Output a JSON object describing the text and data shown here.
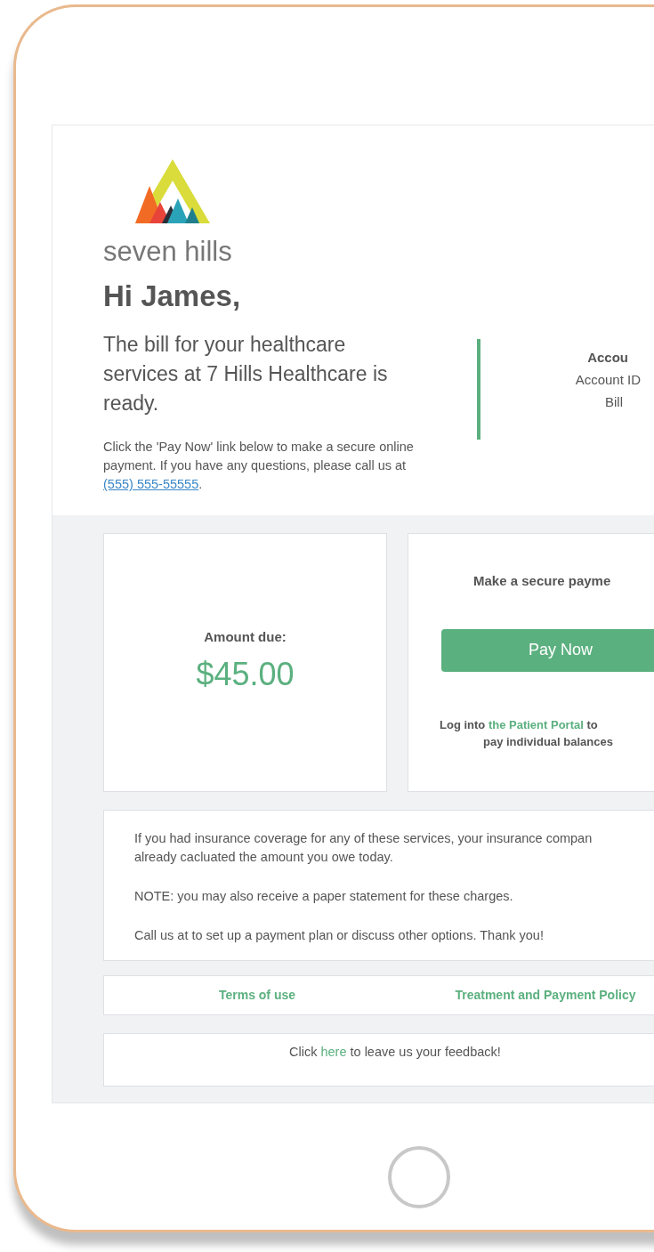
{
  "brand": {
    "name": "seven hills"
  },
  "greeting": "Hi James,",
  "intro": "The bill for your healthcare services at 7 Hills Healthcare is ready.",
  "instructions": {
    "text": "Click the 'Pay Now' link below to make a secure online payment. If you have any questions, please call us at",
    "phone": "(555) 555-55555",
    "after": "."
  },
  "account": {
    "heading": "Accou",
    "lines": [
      "Account ID",
      "Bill"
    ]
  },
  "amount": {
    "label": "Amount due:",
    "value": "$45.00"
  },
  "payment": {
    "heading": "Make a secure payme",
    "button": "Pay Now",
    "portal_before": "Log into",
    "portal_link": "the Patient Portal",
    "portal_after": "to",
    "portal_line2": "pay individual balances"
  },
  "notes": [
    "If you had insurance coverage for any of these services, your insurance compan already cacluated the amount you owe today.",
    "NOTE: you may also receive a paper statement for these charges.",
    "Call us at to set up a payment plan or discuss other options. Thank you!"
  ],
  "footer_links": [
    "Terms of use",
    "Treatment and Payment Policy"
  ],
  "feedback": {
    "before": "Click",
    "link": "here",
    "after": "to leave us your feedback!"
  }
}
